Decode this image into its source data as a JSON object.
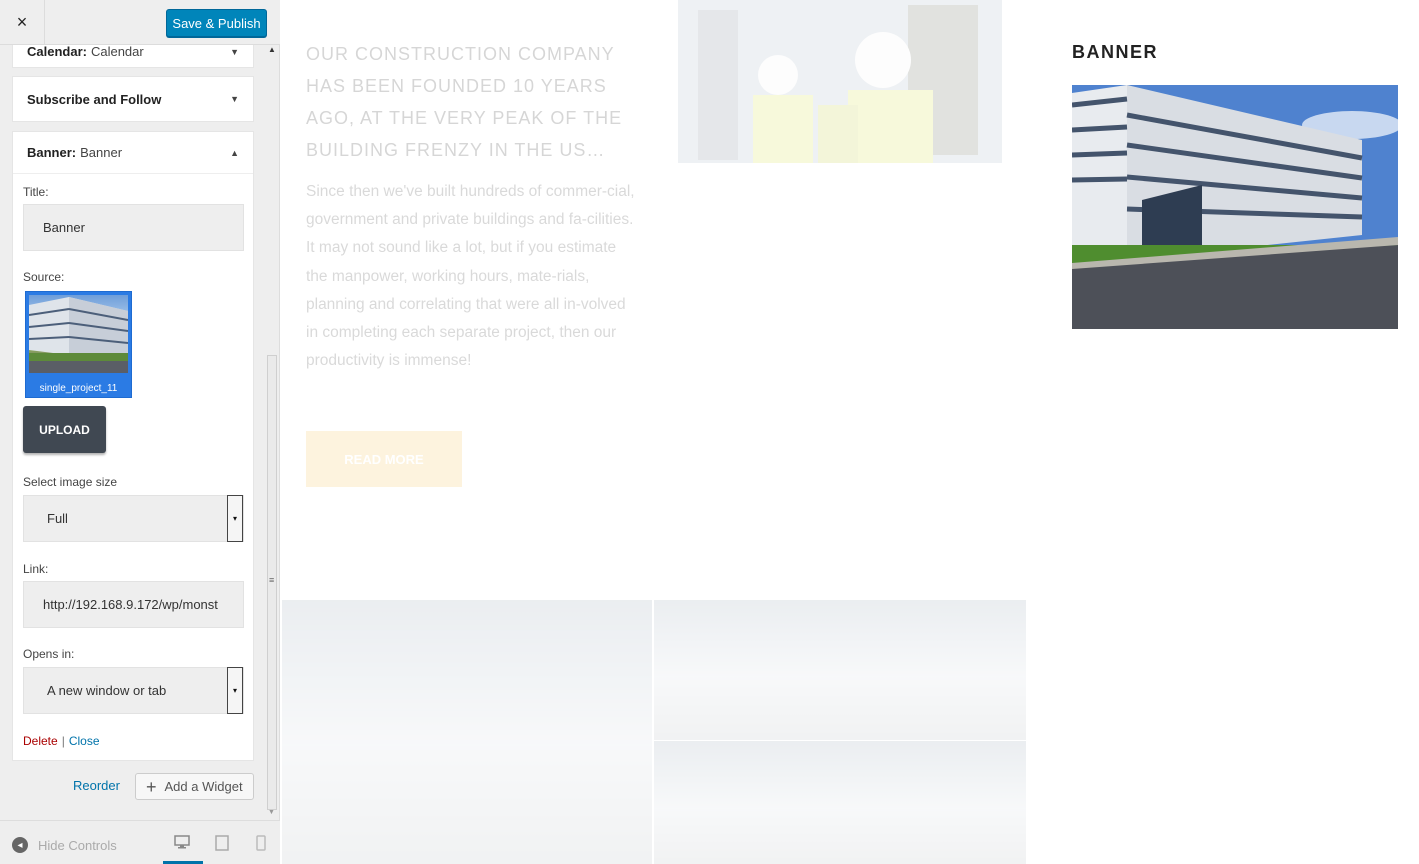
{
  "header": {
    "close_icon": "×",
    "save_label": "Save & Publish"
  },
  "widgets": {
    "calendar": {
      "type": "Calendar:",
      "name": "Calendar",
      "arrow": "▼"
    },
    "subscribe": {
      "type": "Subscribe and Follow",
      "arrow": "▼"
    },
    "banner": {
      "type": "Banner:",
      "name": "Banner",
      "arrow": "▲",
      "title_label": "Title:",
      "title_value": "Banner",
      "source_label": "Source:",
      "source_file": "single_project_11",
      "upload_label": "UPLOAD",
      "size_label": "Select image size",
      "size_value": "Full",
      "link_label": "Link:",
      "link_value": "http://192.168.9.172/wp/monst",
      "opens_label": "Opens in:",
      "opens_value": "A new window or tab",
      "select_arrow": "▾",
      "delete_label": "Delete",
      "separator": "|",
      "close_label": "Close"
    }
  },
  "footer_actions": {
    "reorder_label": "Reorder",
    "add_widget_plus": "+",
    "add_widget_label": "Add a Widget"
  },
  "sidebar_footer": {
    "hide_controls_label": "Hide Controls",
    "hide_icon": "◂",
    "desktop_icon": "🖵",
    "tablet_icon": "▭",
    "mobile_icon": "▯"
  },
  "scrollbar": {
    "up_arrow": "▲",
    "grip": "≡",
    "down_arrow": "▼"
  },
  "preview": {
    "headline": "OUR CONSTRUCTION COMPANY HAS BEEN FOUNDED 10 YEARS AGO, AT THE VERY PEAK OF THE BUILDING FRENZY IN THE US…",
    "body": "Since then we've built hundreds of commer-cial, government and private buildings and fa-cilities. It may not sound like a lot, but if you estimate the manpower, working hours, mate-rials, planning and correlating that were all in-volved in completing each separate project, then our productivity is immense!",
    "read_more": "READ MORE",
    "banner_title": "BANNER"
  },
  "colors": {
    "primary": "#0085ba",
    "accent": "#f6c25b",
    "delete": "#aa0000",
    "link": "#0073aa"
  }
}
